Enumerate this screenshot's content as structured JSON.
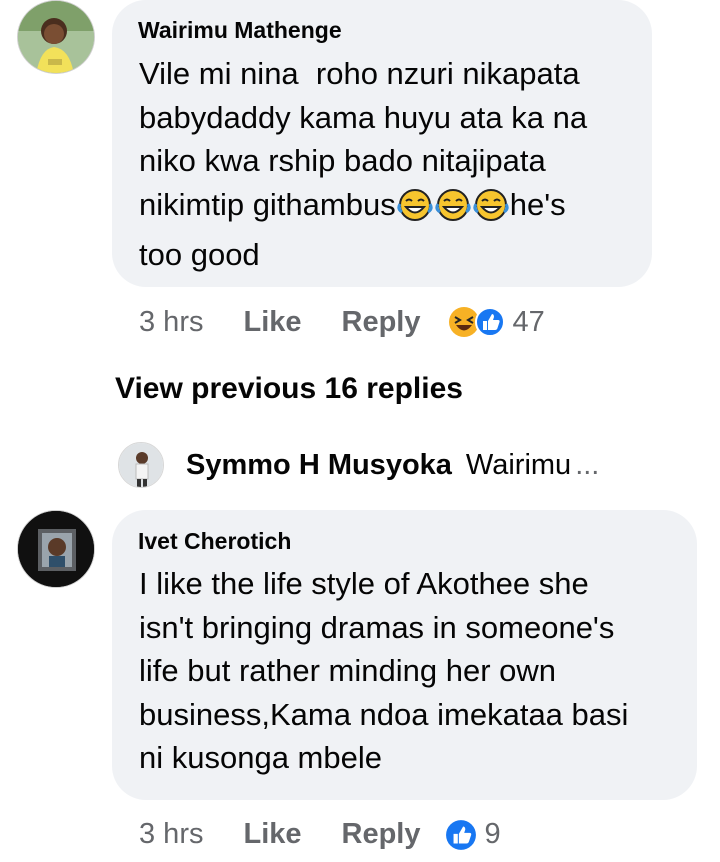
{
  "comments": [
    {
      "author": "Wairimu Mathenge",
      "text_lines": [
        "Vile mi nina  roho nzuri nikapata",
        "babydaddy kama huyu ata ka na",
        "niko kwa rship bado nitajipata"
      ],
      "last_line_pre_emoji": "nikimtip githambus",
      "last_line_post_emoji": "he's",
      "final_line": "too good",
      "emoji_count": 3,
      "time": "3 hrs",
      "like_label": "Like",
      "reply_label": "Reply",
      "reactions": [
        "haha-icon",
        "like-icon"
      ],
      "reaction_count": "47"
    },
    {
      "author": "Ivet Cherotich",
      "text_lines": [
        "I like the life style of Akothee she",
        "isn't bringing dramas in someone's",
        "life but rather minding her own",
        "business,Kama ndoa imekataa basi",
        "ni kusonga mbele"
      ],
      "time": "3 hrs",
      "like_label": "Like",
      "reply_label": "Reply",
      "reactions": [
        "like-icon"
      ],
      "reaction_count": "9"
    }
  ],
  "view_previous": "View previous 16 replies",
  "reply_preview": {
    "author": "Symmo H Musyoka",
    "text": "Wairimu",
    "ellipsis": "..."
  },
  "colors": {
    "bubble": "#f0f2f5",
    "meta": "#65676b",
    "like_blue": "#1877f2",
    "haha_yellow": "#f7b125"
  }
}
